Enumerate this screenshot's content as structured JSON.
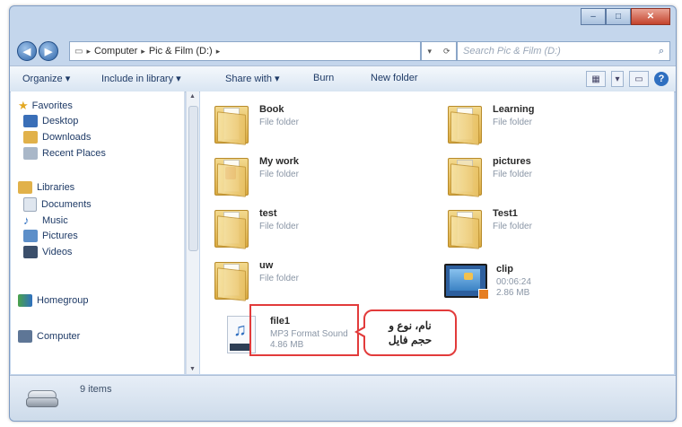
{
  "address": {
    "crumbs": [
      "Computer",
      "Pic & Film (D:)"
    ],
    "search_placeholder": "Search Pic & Film (D:)"
  },
  "toolbar": {
    "organize": "Organize ▾",
    "include": "Include in library ▾",
    "share": "Share with ▾",
    "burn": "Burn",
    "new_folder": "New folder"
  },
  "nav": {
    "favorites": "Favorites",
    "desktop": "Desktop",
    "downloads": "Downloads",
    "recent": "Recent Places",
    "libraries": "Libraries",
    "documents": "Documents",
    "music": "Music",
    "pictures": "Pictures",
    "videos": "Videos",
    "homegroup": "Homegroup",
    "computer": "Computer"
  },
  "files": [
    {
      "name": "Book",
      "type": "File folder",
      "icon": "folder-icon"
    },
    {
      "name": "Learning",
      "type": "File folder",
      "icon": "folder-icon"
    },
    {
      "name": "My work",
      "type": "File folder",
      "icon": "folder-icon"
    },
    {
      "name": "pictures",
      "type": "File folder",
      "icon": "folder-icon"
    },
    {
      "name": "test",
      "type": "File folder",
      "icon": "folder-icon"
    },
    {
      "name": "Test1",
      "type": "File folder",
      "icon": "folder-icon"
    },
    {
      "name": "uw",
      "type": "File folder",
      "icon": "folder-icon"
    },
    {
      "name": "clip",
      "type": "00:06:24",
      "size": "2.86 MB",
      "icon": "video-icon"
    },
    {
      "name": "file1",
      "type": "MP3 Format Sound",
      "size": "4.86 MB",
      "icon": "audio-icon"
    }
  ],
  "callout": {
    "line1": "نام، نوع و",
    "line2": "حجم فایل"
  },
  "status": {
    "count": "9 items"
  },
  "colors": {
    "highlight": "#e23b3b",
    "window_frame": "#c4d6ec"
  }
}
